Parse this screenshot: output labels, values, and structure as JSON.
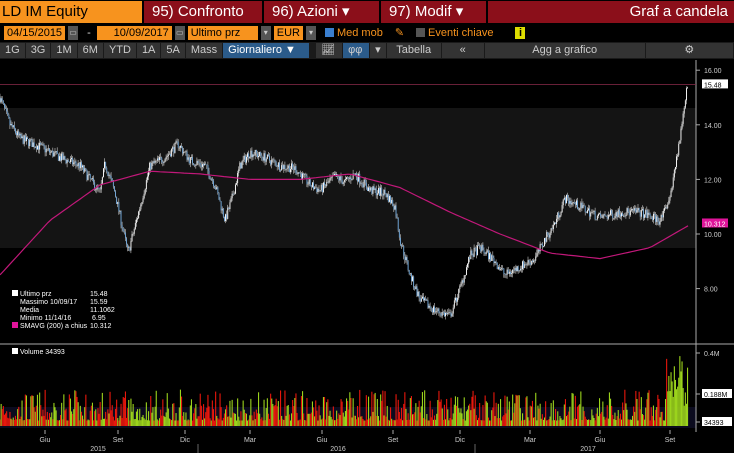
{
  "header": {
    "ticker": "LD IM Equity",
    "menu": [
      {
        "label": "95) Confronto"
      },
      {
        "label": "96) Azioni",
        "dd": "▾"
      },
      {
        "label": "97) Modif",
        "dd": "▾"
      }
    ],
    "title": "Graf a candela"
  },
  "controls": {
    "start_date": "04/15/2015",
    "sep": "-",
    "end_date": "10/09/2017",
    "field": "Ultimo prz",
    "currency": "EUR",
    "med_mob": "Med mob",
    "eventi": "Eventi chiave",
    "info": "i"
  },
  "toolbar": {
    "periods": [
      "1G",
      "3G",
      "1M",
      "6M",
      "YTD",
      "1A",
      "5A",
      "Mass"
    ],
    "frequency": "Giornaliero ▼",
    "tabella": "Tabella",
    "collapse": "«",
    "add": "Agg a grafico",
    "settings": "⚙"
  },
  "legend": [
    {
      "label": "Ultimo prz",
      "value": "15.48"
    },
    {
      "label": "Massimo 10/09/17",
      "value": "15.59"
    },
    {
      "label": "Media",
      "value": "11.1062"
    },
    {
      "label": "Minimo 11/14/16",
      "value": "6.95"
    },
    {
      "label": "SMAVG (200) a chius",
      "value": "10.312"
    }
  ],
  "volume_legend": "Volume 34393",
  "colors": {
    "price": "#6fa8dc",
    "sma": "#c2187a",
    "up": "#9bd31c",
    "down": "#e8170c"
  },
  "chart_data": {
    "type": "candlestick",
    "ylim": [
      6,
      16.3
    ],
    "yticks": [
      "16.00",
      "14.00",
      "12.00",
      "10.00",
      "8.00"
    ],
    "last_label": "15.48",
    "sma_label": "10.312",
    "volume_ticks": [
      "0.4M",
      "0.188M",
      "34393"
    ],
    "volume_max": 0.42,
    "xticks": [
      "Giu",
      "Set",
      "Dic",
      "Mar",
      "Giu",
      "Set",
      "Dic",
      "Mar",
      "Giu",
      "Set"
    ],
    "years": [
      "2015",
      "2016",
      "2017"
    ],
    "price": [
      [
        0,
        15.0
      ],
      [
        10,
        14.0
      ],
      [
        20,
        13.5
      ],
      [
        40,
        13.2
      ],
      [
        60,
        12.8
      ],
      [
        80,
        12.5
      ],
      [
        100,
        11.5
      ],
      [
        105,
        12.6
      ],
      [
        115,
        11.5
      ],
      [
        128,
        9.3
      ],
      [
        140,
        11.0
      ],
      [
        150,
        12.5
      ],
      [
        165,
        12.8
      ],
      [
        178,
        13.3
      ],
      [
        190,
        12.7
      ],
      [
        205,
        12.5
      ],
      [
        215,
        11.8
      ],
      [
        225,
        10.5
      ],
      [
        232,
        11.3
      ],
      [
        240,
        12.5
      ],
      [
        250,
        13.0
      ],
      [
        265,
        12.8
      ],
      [
        280,
        12.5
      ],
      [
        295,
        12.4
      ],
      [
        310,
        11.8
      ],
      [
        320,
        11.6
      ],
      [
        335,
        12.1
      ],
      [
        345,
        11.9
      ],
      [
        355,
        12.2
      ],
      [
        370,
        11.6
      ],
      [
        385,
        11.5
      ],
      [
        395,
        11.0
      ],
      [
        400,
        9.8
      ],
      [
        410,
        8.5
      ],
      [
        420,
        7.6
      ],
      [
        435,
        7.2
      ],
      [
        450,
        7.0
      ],
      [
        460,
        8.0
      ],
      [
        470,
        9.2
      ],
      [
        480,
        9.5
      ],
      [
        495,
        9.0
      ],
      [
        505,
        8.5
      ],
      [
        520,
        8.8
      ],
      [
        535,
        9.1
      ],
      [
        545,
        9.8
      ],
      [
        555,
        10.4
      ],
      [
        565,
        11.3
      ],
      [
        580,
        11.0
      ],
      [
        600,
        10.6
      ],
      [
        620,
        10.8
      ],
      [
        640,
        10.8
      ],
      [
        660,
        10.5
      ],
      [
        668,
        11.0
      ],
      [
        675,
        12.5
      ],
      [
        680,
        13.5
      ],
      [
        685,
        15.0
      ],
      [
        688,
        15.48
      ]
    ],
    "sma200": [
      [
        0,
        8.5
      ],
      [
        50,
        10.5
      ],
      [
        100,
        11.8
      ],
      [
        150,
        12.3
      ],
      [
        200,
        12.2
      ],
      [
        250,
        12.0
      ],
      [
        300,
        12.0
      ],
      [
        350,
        12.2
      ],
      [
        400,
        11.7
      ],
      [
        450,
        10.8
      ],
      [
        500,
        10.0
      ],
      [
        550,
        9.3
      ],
      [
        600,
        9.1
      ],
      [
        650,
        9.5
      ],
      [
        688,
        10.3
      ]
    ]
  }
}
